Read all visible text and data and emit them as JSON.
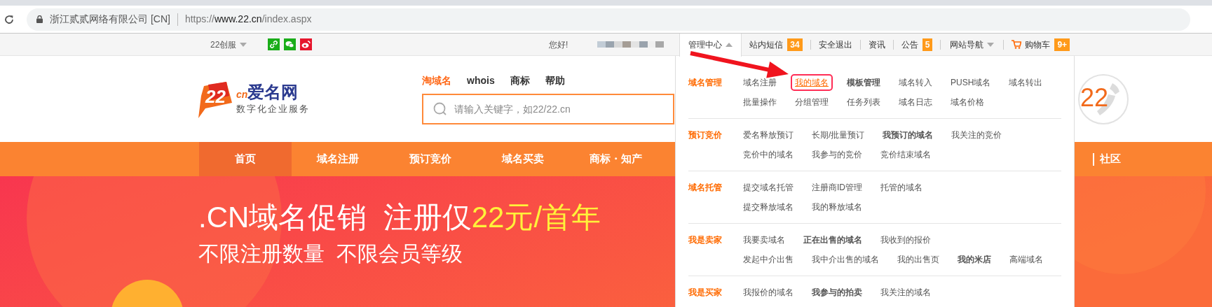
{
  "browser": {
    "host_label": "浙江贰贰网络有限公司 [CN]",
    "url_scheme": "https://",
    "url_domain": "www.22.cn",
    "url_path": "/index.aspx"
  },
  "topbar": {
    "service_menu": "22创服",
    "greeting": "您好!",
    "links": [
      {
        "label": "管理中心",
        "kind": "dropdown",
        "expanded": true
      },
      {
        "label": "站内短信",
        "kind": "badge",
        "badge": "34"
      },
      {
        "label": "安全退出",
        "kind": "plain"
      },
      {
        "label": "资讯",
        "kind": "plain"
      },
      {
        "label": "公告",
        "kind": "badge",
        "badge": "5"
      },
      {
        "label": "网站导航",
        "kind": "dropdown",
        "expanded": false
      },
      {
        "label": "购物车",
        "kind": "cart",
        "badge": "9+"
      }
    ]
  },
  "header": {
    "logo": {
      "mark": "22",
      "suffix": "cn",
      "name": "爱名网",
      "tagline": "数字化企业服务"
    },
    "search_tabs": [
      {
        "label": "淘域名",
        "selected": true
      },
      {
        "label": "whois",
        "selected": false
      },
      {
        "label": "商标",
        "selected": false
      },
      {
        "label": "帮助",
        "selected": false
      }
    ],
    "search": {
      "placeholder": "请输入关键字，如22/22.cn"
    },
    "hotline": "22"
  },
  "nav": {
    "items": [
      {
        "label": "首页",
        "selected": true
      },
      {
        "label": "域名注册",
        "selected": false
      },
      {
        "label": "预订竞价",
        "selected": false
      },
      {
        "label": "域名买卖",
        "selected": false
      },
      {
        "label": "商标・知产",
        "selected": false
      }
    ],
    "right_items": [
      "社区"
    ]
  },
  "hero": {
    "title": ".CN域名促销  注册仅",
    "title_highlight": "22元/首年",
    "subtitle": "不限注册数量  不限会员等级"
  },
  "menu": {
    "sections": [
      {
        "title": "域名管理",
        "rows": [
          [
            {
              "label": "域名注册",
              "bold": false,
              "selected": false
            },
            {
              "label": "我的域名",
              "bold": false,
              "selected": true
            },
            {
              "label": "模板管理",
              "bold": true,
              "selected": false
            },
            {
              "label": "域名转入",
              "bold": false,
              "selected": false
            },
            {
              "label": "PUSH域名",
              "bold": false,
              "selected": false
            },
            {
              "label": "域名转出",
              "bold": false,
              "selected": false
            }
          ],
          [
            {
              "label": "批量操作",
              "bold": false,
              "selected": false
            },
            {
              "label": "分组管理",
              "bold": false,
              "selected": false
            },
            {
              "label": "任务列表",
              "bold": false,
              "selected": false
            },
            {
              "label": "域名日志",
              "bold": false,
              "selected": false
            },
            {
              "label": "域名价格",
              "bold": false,
              "selected": false
            }
          ]
        ]
      },
      {
        "title": "预订竞价",
        "rows": [
          [
            {
              "label": "爱名释放预订",
              "bold": false,
              "selected": false
            },
            {
              "label": "长期/批量预订",
              "bold": false,
              "selected": false
            },
            {
              "label": "我预订的域名",
              "bold": true,
              "selected": false
            },
            {
              "label": "我关注的竞价",
              "bold": false,
              "selected": false
            }
          ],
          [
            {
              "label": "竞价中的域名",
              "bold": false,
              "selected": false
            },
            {
              "label": "我参与的竞价",
              "bold": false,
              "selected": false
            },
            {
              "label": "竞价结束域名",
              "bold": false,
              "selected": false
            }
          ]
        ]
      },
      {
        "title": "域名托管",
        "rows": [
          [
            {
              "label": "提交域名托管",
              "bold": false,
              "selected": false
            },
            {
              "label": "注册商ID管理",
              "bold": false,
              "selected": false
            },
            {
              "label": "托管的域名",
              "bold": false,
              "selected": false
            }
          ],
          [
            {
              "label": "提交释放域名",
              "bold": false,
              "selected": false
            },
            {
              "label": "我的释放域名",
              "bold": false,
              "selected": false
            }
          ]
        ]
      },
      {
        "title": "我是卖家",
        "rows": [
          [
            {
              "label": "我要卖域名",
              "bold": false,
              "selected": false
            },
            {
              "label": "正在出售的域名",
              "bold": true,
              "selected": false
            },
            {
              "label": "我收到的报价",
              "bold": false,
              "selected": false
            }
          ],
          [
            {
              "label": "发起中介出售",
              "bold": false,
              "selected": false
            },
            {
              "label": "我中介出售的域名",
              "bold": false,
              "selected": false
            },
            {
              "label": "我的出售页",
              "bold": false,
              "selected": false
            },
            {
              "label": "我的米店",
              "bold": true,
              "selected": false
            },
            {
              "label": "高端域名",
              "bold": false,
              "selected": false
            }
          ]
        ]
      },
      {
        "title": "我是买家",
        "rows": [
          [
            {
              "label": "我报价的域名",
              "bold": false,
              "selected": false
            },
            {
              "label": "我参与的拍卖",
              "bold": true,
              "selected": false
            },
            {
              "label": "我关注的域名",
              "bold": false,
              "selected": false
            }
          ]
        ]
      }
    ]
  }
}
